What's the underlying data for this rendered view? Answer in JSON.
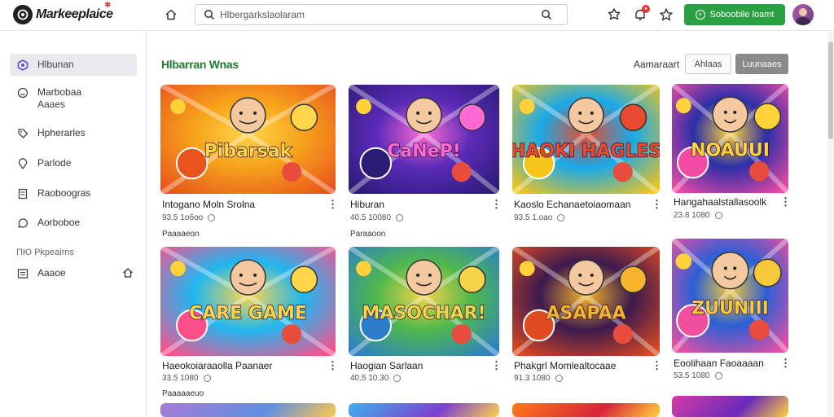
{
  "header": {
    "logo_text": "Markeeplaice",
    "search_placeholder": "Hlbergarkslaolaram",
    "cta_label": "Soboobile loamt"
  },
  "sidebar": {
    "items": [
      {
        "label": "Hlbunan",
        "icon": "hex-icon",
        "active": true
      },
      {
        "label": "Marbobaa",
        "sub": "Aaaes",
        "icon": "smiley-icon"
      },
      {
        "label": "Hpherarles",
        "icon": "tag-icon"
      },
      {
        "label": "Parlode",
        "icon": "location-icon"
      },
      {
        "label": "Raoboogras",
        "icon": "document-icon"
      },
      {
        "label": "Aorboboe",
        "icon": "chat-icon"
      }
    ],
    "heading": "ПЮ Pkpeairns",
    "last_item": {
      "label": "Aaaoe",
      "icon": "list-icon",
      "trail_icon": "home-icon"
    }
  },
  "main": {
    "section_title": "Hlbarran Wnas",
    "sort_label": "Aamaraart",
    "filter_a": "Ahlaas",
    "filter_b": "Luunaaes"
  },
  "cards": [
    {
      "title": "Intogano Moln Srolna",
      "meta": "93.5 1обоо",
      "tag": "Paaaaeon",
      "art": "Pibarsak",
      "palette": [
        "#f7a21b",
        "#e8531e",
        "#ffd54a"
      ]
    },
    {
      "title": "Hiburan",
      "meta": "40.5 10080",
      "tag": "Paraaoon",
      "art": "CaNeP!",
      "palette": [
        "#5b2bb8",
        "#2a1b74",
        "#ff6ad5"
      ]
    },
    {
      "title": "Kaoslo Echanaetoiaomaan",
      "meta": "93.5 1.оао",
      "tag": "",
      "art": "HAOKI HAGLES",
      "palette": [
        "#1aa9e8",
        "#f5c518",
        "#e84a2d"
      ]
    },
    {
      "title": "Hangahaalstallasoolk",
      "meta": "23.8 1080",
      "tag": "",
      "art": "NOAUUI",
      "palette": [
        "#2c2fa8",
        "#f34aa4",
        "#ffd23a"
      ]
    },
    {
      "title": "Haeokoiaraaolla Paanaer",
      "meta": "33.5 1080",
      "tag": "Paaaaaeuo",
      "art": "CARE GAME",
      "palette": [
        "#20b7f0",
        "#ff4f8b",
        "#ffd64a"
      ]
    },
    {
      "title": "Haogian Sarlaan",
      "meta": "40.5 10.30",
      "tag": "",
      "art": "MASOCHAR!",
      "palette": [
        "#4fb84c",
        "#2d7ec9",
        "#f5d547"
      ]
    },
    {
      "title": "Phakgrl Momlealtocaae",
      "meta": "91.3 1080",
      "tag": "",
      "art": "ASAPAA",
      "palette": [
        "#3c1a4e",
        "#e04a1f",
        "#f7b42c"
      ]
    },
    {
      "title": "Eoolihaan Faoaaaan",
      "meta": "53.5 1080",
      "tag": "",
      "art": "ZUUNIII",
      "palette": [
        "#2b5fd6",
        "#f04fa0",
        "#f5c93a"
      ]
    }
  ]
}
